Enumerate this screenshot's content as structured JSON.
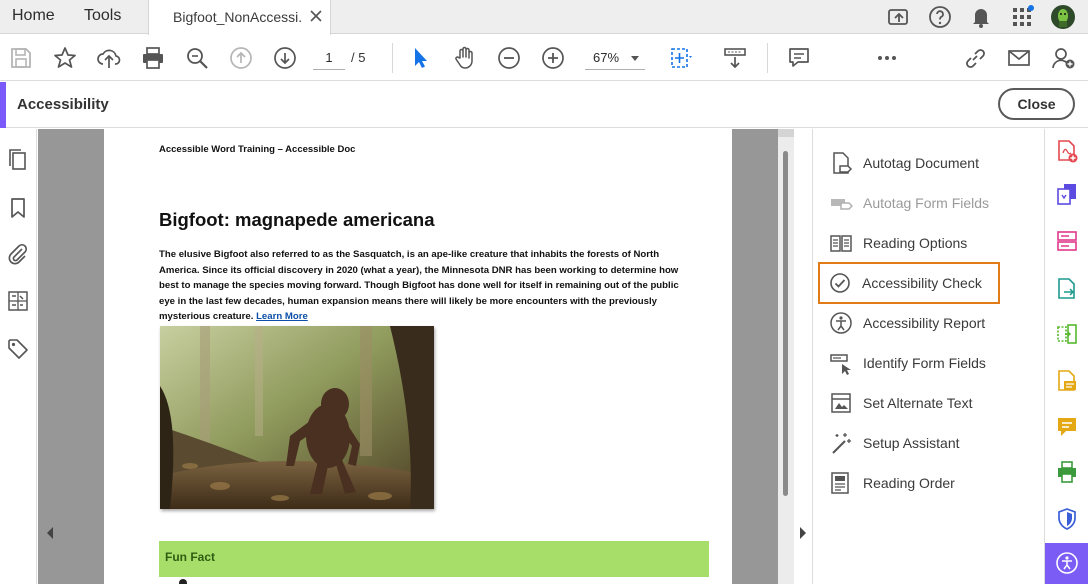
{
  "tabs": {
    "home": "Home",
    "tools": "Tools",
    "document": "Bigfoot_NonAccessi..."
  },
  "toolbar": {
    "page_current": "1",
    "page_total": "/ 5",
    "zoom": "67%"
  },
  "panel": {
    "title": "Accessibility",
    "close_label": "Close"
  },
  "document": {
    "header": "Accessible Word Training – Accessible Doc",
    "heading": "Bigfoot: magnapede americana",
    "paragraph": "The elusive Bigfoot also referred to as the Sasquatch, is an ape-like creature that inhabits the forests of North America. Since its official discovery in 2020 (what a year), the Minnesota DNR has been working to determine how best to manage the species moving forward. Though Bigfoot has done well for itself in remaining out of the public eye in the last few decades, human expansion means there will likely be more encounters with the previously mysterious creature.",
    "link": "Learn More",
    "fun_fact": "Fun Fact"
  },
  "tools": [
    {
      "label": "Autotag Document",
      "icon": "autotag-document-icon",
      "disabled": false,
      "selected": false
    },
    {
      "label": "Autotag Form Fields",
      "icon": "autotag-form-fields-icon",
      "disabled": true,
      "selected": false
    },
    {
      "label": "Reading Options",
      "icon": "reading-options-icon",
      "disabled": false,
      "selected": false
    },
    {
      "label": "Accessibility Check",
      "icon": "accessibility-check-icon",
      "disabled": false,
      "selected": true
    },
    {
      "label": "Accessibility Report",
      "icon": "accessibility-report-icon",
      "disabled": false,
      "selected": false
    },
    {
      "label": "Identify Form Fields",
      "icon": "identify-form-fields-icon",
      "disabled": false,
      "selected": false
    },
    {
      "label": "Set Alternate Text",
      "icon": "set-alternate-text-icon",
      "disabled": false,
      "selected": false
    },
    {
      "label": "Setup Assistant",
      "icon": "setup-assistant-icon",
      "disabled": false,
      "selected": false
    },
    {
      "label": "Reading Order",
      "icon": "reading-order-icon",
      "disabled": false,
      "selected": false
    }
  ],
  "colors": {
    "accent": "#7a5af8",
    "selection": "#e07b18",
    "fun_fact_bg": "#a7de6a",
    "viewport": "#979797"
  }
}
